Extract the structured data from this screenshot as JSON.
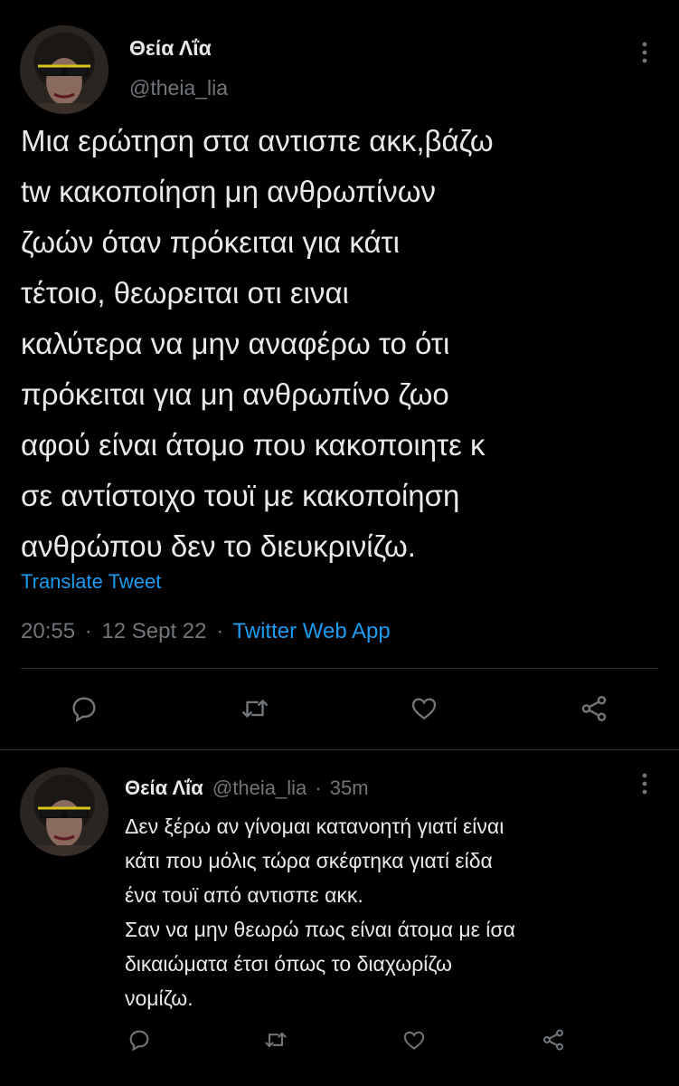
{
  "main_tweet": {
    "author_name": "Θεία Λΐα",
    "author_handle": "@theia_lia",
    "text_lines": [
      "Μια ερώτηση στα αντισπε ακκ,βάζω",
      "tw κακοποίηση μη ανθρωπίνων",
      "ζωών όταν πρόκειται για κάτι",
      "τέτοιο, θεωρειται οτι ειναι",
      "καλύτερα να μην αναφέρω το ότι",
      "πρόκειται για μη ανθρωπίνο ζωο",
      "αφού είναι άτομο που κακοποιητε κ",
      "σε αντίστοιχο τουϊ με κακοποίηση",
      "ανθρώπου δεν το διευκρινίζω."
    ],
    "translate_label": "Translate Tweet",
    "time": "20:55",
    "date": "12 Sept 22",
    "separator": "·",
    "source": "Twitter Web App"
  },
  "reply_tweet": {
    "author_name": "Θεία Λΐα",
    "author_handle": "@theia_lia",
    "separator": "·",
    "time_ago": "35m",
    "text_lines": [
      "Δεν ξέρω αν γίνομαι κατανοητή γιατί είναι",
      "κάτι που μόλις τώρα σκέφτηκα γιατί είδα",
      "ένα τουϊ από αντισπε ακκ.",
      "Σαν να μην θεωρώ πως είναι άτομα με ίσα",
      "δικαιώματα έτσι όπως το διαχωρίζω",
      "νομίζω."
    ]
  },
  "icons": {
    "more": "more-vertical-icon",
    "reply": "reply-icon",
    "retweet": "retweet-icon",
    "like": "like-icon",
    "share": "share-icon"
  },
  "colors": {
    "background": "#000000",
    "text": "#e7e9ea",
    "muted": "#71767b",
    "link": "#1d9bf0",
    "divider": "#2f3336"
  }
}
